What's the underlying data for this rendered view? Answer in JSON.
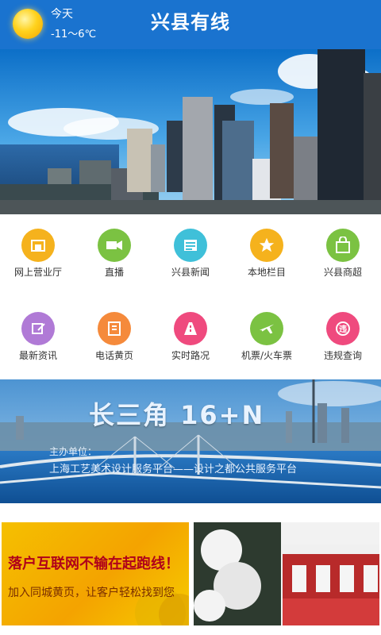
{
  "header": {
    "title": "兴县有线",
    "weather": {
      "day_label": "今天",
      "temperature_range": "-11～6℃"
    }
  },
  "grid": {
    "items": [
      {
        "label": "网上营业厅",
        "icon": "storefront-icon",
        "color": "#f5b21d"
      },
      {
        "label": "直播",
        "icon": "video-camera-icon",
        "color": "#7bc242"
      },
      {
        "label": "兴县新闻",
        "icon": "news-icon",
        "color": "#3fc0d9"
      },
      {
        "label": "本地栏目",
        "icon": "star-icon",
        "color": "#f5b21d"
      },
      {
        "label": "兴县商超",
        "icon": "shopping-bag-icon",
        "color": "#7bc242"
      },
      {
        "label": "最新资讯",
        "icon": "edit-note-icon",
        "color": "#b07ad6"
      },
      {
        "label": "电话黄页",
        "icon": "phone-book-icon",
        "color": "#f58a3b"
      },
      {
        "label": "实时路况",
        "icon": "road-icon",
        "color": "#ef4a7e"
      },
      {
        "label": "机票/火车票",
        "icon": "airplane-icon",
        "color": "#7bc242"
      },
      {
        "label": "违规查询",
        "icon": "violation-icon",
        "color": "#ef4a7e"
      }
    ]
  },
  "mid_banner": {
    "headline": "长三角 16+N",
    "subtitle": "主办单位：",
    "line": "上海工艺美术设计服务平台——设计之都公共服务平台"
  },
  "bottom_cards": {
    "left": {
      "line1": "落户互联网不输在起跑线！",
      "line2": "加入同城黄页，让客户轻松找到您"
    }
  }
}
